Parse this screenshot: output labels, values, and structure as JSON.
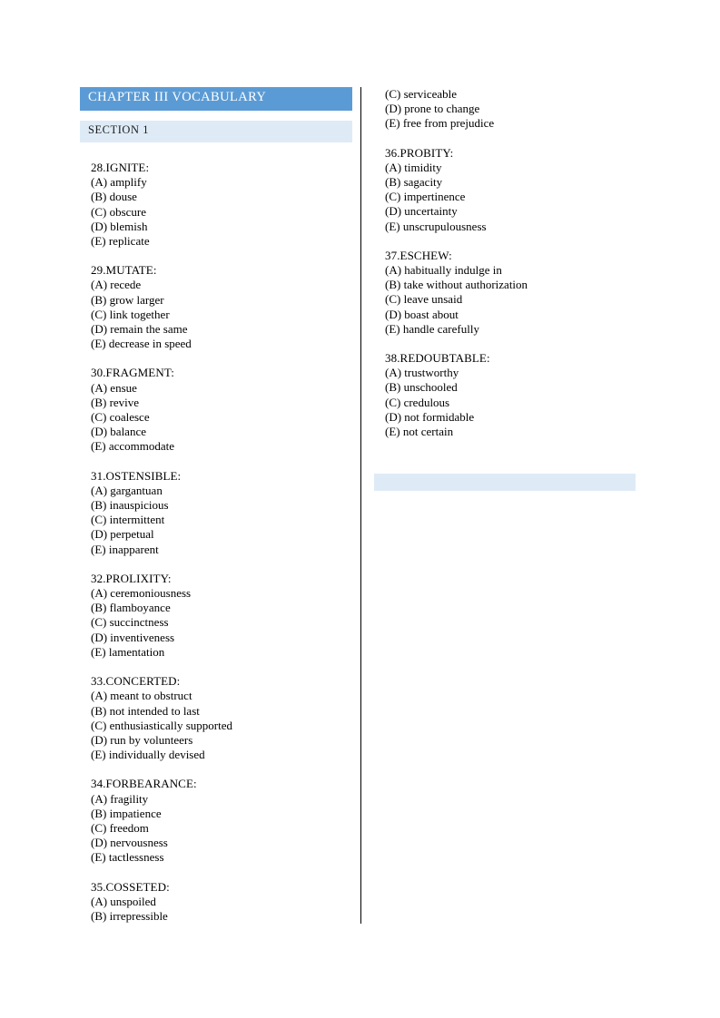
{
  "document": {
    "chapter_banner": "CHAPTER III VOCABULARY",
    "section_banner": "SECTION 1",
    "blank_banner": ""
  },
  "left_column": {
    "questions": [
      {
        "stem": "28.IGNITE:",
        "options": [
          "(A) amplify",
          "(B) douse",
          "(C) obscure",
          "(D) blemish",
          "(E) replicate"
        ]
      },
      {
        "stem": "29.MUTATE:",
        "options": [
          "(A) recede",
          "(B) grow larger",
          "(C) link together",
          "(D) remain the same",
          "(E) decrease in speed"
        ]
      },
      {
        "stem": "30.FRAGMENT:",
        "options": [
          "(A) ensue",
          "(B) revive",
          "(C) coalesce",
          "(D) balance",
          "(E) accommodate"
        ]
      },
      {
        "stem": "31.OSTENSIBLE:",
        "options": [
          "(A) gargantuan",
          "(B) inauspicious",
          "(C) intermittent",
          "(D) perpetual",
          "(E) inapparent"
        ]
      },
      {
        "stem": "32.PROLIXITY:",
        "options": [
          "(A) ceremoniousness",
          "(B) flamboyance",
          "(C) succinctness",
          "(D) inventiveness",
          "(E) lamentation"
        ]
      },
      {
        "stem": "33.CONCERTED:",
        "options": [
          "(A) meant to obstruct",
          "(B) not intended to last",
          "(C) enthusiastically supported",
          "(D) run by volunteers",
          "(E) individually devised"
        ]
      },
      {
        "stem": "34.FORBEARANCE:",
        "options": [
          "(A) fragility",
          "(B) impatience",
          "(C) freedom",
          "(D) nervousness",
          "(E) tactlessness"
        ]
      },
      {
        "stem": "35.COSSETED:",
        "options": [
          "(A) unspoiled",
          "(B) irrepressible"
        ]
      }
    ]
  },
  "right_column": {
    "continued_options": [
      "(C) serviceable",
      "(D) prone to change",
      "(E) free from prejudice"
    ],
    "questions": [
      {
        "stem": "36.PROBITY:",
        "options": [
          "(A) timidity",
          "(B) sagacity",
          "(C) impertinence",
          "(D) uncertainty",
          "(E) unscrupulousness"
        ]
      },
      {
        "stem": "37.ESCHEW:",
        "options": [
          "(A) habitually indulge in",
          "(B) take without authorization",
          "(C) leave unsaid",
          "(D) boast about",
          "(E) handle carefully"
        ]
      },
      {
        "stem": "38.REDOUBTABLE:",
        "options": [
          "(A) trustworthy",
          "(B) unschooled",
          "(C) credulous",
          "(D) not formidable",
          "(E) not certain"
        ]
      }
    ]
  },
  "colors": {
    "chapter_banner_bg": "#5b9bd5",
    "section_banner_bg": "#deebf7",
    "divider": "#000000",
    "text": "#000000",
    "page_bg": "#ffffff"
  }
}
